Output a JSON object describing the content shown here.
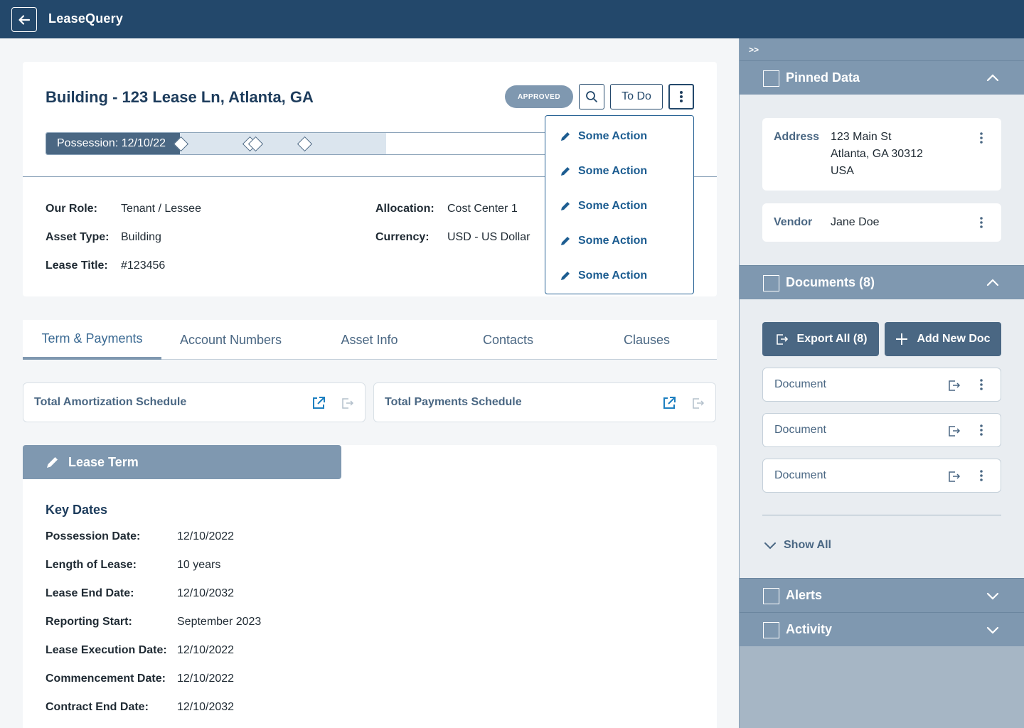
{
  "app": {
    "title": "LeaseQuery"
  },
  "header": {
    "lease_title": "Building - 123 Lease Ln, Atlanta, GA",
    "status": "APPROVED",
    "todo_label": "To Do",
    "timeline_label": "Possession: 12/10/22"
  },
  "details": {
    "our_role_label": "Our Role:",
    "our_role": "Tenant / Lessee",
    "asset_type_label": "Asset Type:",
    "asset_type": "Building",
    "lease_title_label": "Lease Title:",
    "lease_title_value": "#123456",
    "allocation_label": "Allocation:",
    "allocation": "Cost Center 1",
    "currency_label": "Currency:",
    "currency": "USD - US Dollar"
  },
  "menu": {
    "items": [
      "Some Action",
      "Some Action",
      "Some Action",
      "Some Action",
      "Some Action"
    ]
  },
  "tabs": [
    "Term & Payments",
    "Account Numbers",
    "Asset Info",
    "Contacts",
    "Clauses"
  ],
  "schedules": [
    "Total Amortization Schedule",
    "Total Payments Schedule"
  ],
  "lease_term": {
    "header": "Lease Term",
    "section_title": "Key Dates",
    "rows": [
      {
        "label": "Possession Date:",
        "value": "12/10/2022"
      },
      {
        "label": "Length of Lease:",
        "value": "10 years"
      },
      {
        "label": "Lease End Date:",
        "value": "12/10/2032"
      },
      {
        "label": "Reporting Start:",
        "value": "September 2023"
      },
      {
        "label": "Lease Execution Date:",
        "value": "12/10/2022"
      },
      {
        "label": "Commencement Date:",
        "value": "12/10/2022"
      },
      {
        "label": "Contract End Date:",
        "value": "12/10/2032"
      }
    ]
  },
  "sidebar": {
    "collapse_label": ">>",
    "pinned_title": "Pinned Data",
    "pinned": {
      "address_label": "Address",
      "address_line1": "123 Main St",
      "address_line2": "Atlanta, GA 30312",
      "address_line3": "USA",
      "vendor_label": "Vendor",
      "vendor": "Jane Doe"
    },
    "documents_title": "Documents (8)",
    "export_label": "Export All (8)",
    "add_label": "Add New Doc",
    "documents": [
      "Document",
      "Document",
      "Document"
    ],
    "show_all": "Show All",
    "alerts_title": "Alerts",
    "activity_title": "Activity"
  }
}
